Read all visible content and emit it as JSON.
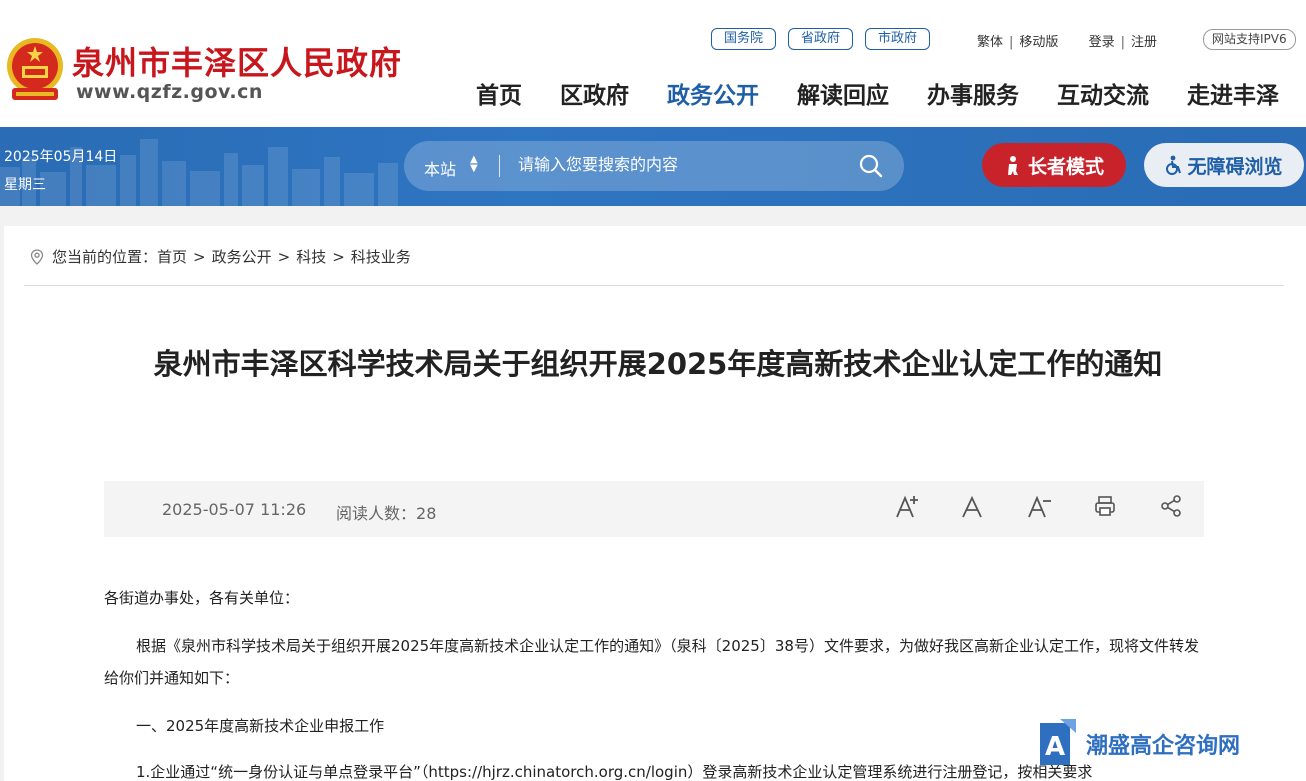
{
  "header": {
    "site_name": "泉州市丰泽区人民政府",
    "site_url": "www.qzfz.gov.cn",
    "gov_links": [
      "国务院",
      "省政府",
      "市政府"
    ],
    "util_links": [
      "繁体",
      "移动版",
      "登录",
      "注册"
    ],
    "ipv6_label": "网站支持IPV6",
    "nav": [
      "首页",
      "区政府",
      "政务公开",
      "解读回应",
      "办事服务",
      "互动交流",
      "走进丰泽"
    ],
    "active_nav": "政务公开",
    "accent_color": "#1f5fa6",
    "brand_red": "#c8161d"
  },
  "bluebar": {
    "date": "2025年05月14日",
    "weekday": "星期三",
    "search_scope": "本站",
    "search_placeholder": "请输入您要搜索的内容",
    "elder_mode_label": "长者模式",
    "accessibility_label": "无障碍浏览"
  },
  "breadcrumb": {
    "prefix": "您当前的位置：",
    "items": [
      "首页",
      "政务公开",
      "科技",
      "科技业务"
    ],
    "separator": ">"
  },
  "article": {
    "title": "泉州市丰泽区科学技术局关于组织开展2025年度高新技术企业认定工作的通知",
    "date": "2025-05-07 11:26",
    "reads_label": "阅读人数：",
    "reads": "28",
    "tools": [
      "font-increase-icon",
      "font-default-icon",
      "font-decrease-icon",
      "print-icon",
      "share-icon"
    ],
    "paragraphs": [
      "各街道办事处，各有关单位：",
      "根据《泉州市科学技术局关于组织开展2025年度高新技术企业认定工作的通知》（泉科〔2025〕38号）文件要求，为做好我区高新企业认定工作，现将文件转发给你们并通知如下：",
      "一、2025年度高新技术企业申报工作",
      "1.企业通过“统一身份认证与单点登录平台”（https://hjrz.chinatorch.org.cn/login）登录高新技术企业认定管理系统进行注册登记，按相关要求"
    ]
  },
  "watermark": {
    "text": "潮盛高企咨询网"
  }
}
